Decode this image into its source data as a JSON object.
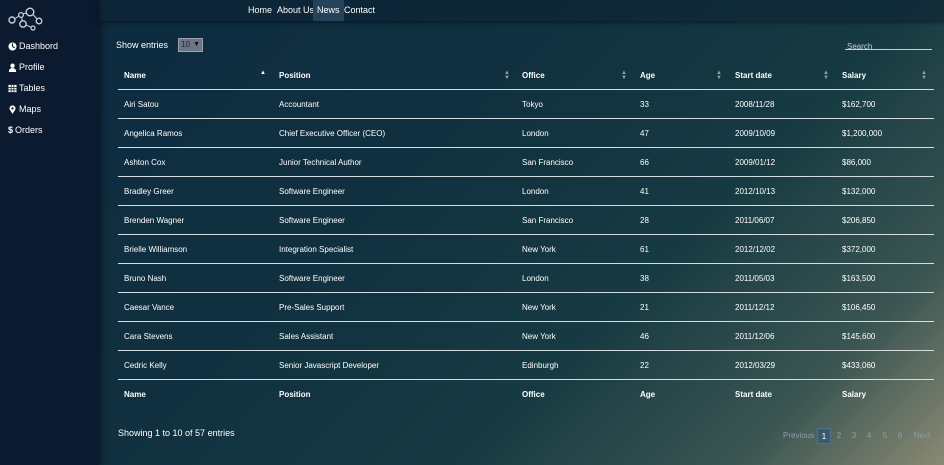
{
  "sidebar": {
    "items": [
      {
        "label": "Dashbord",
        "icon": "dashboard-icon"
      },
      {
        "label": "Profile",
        "icon": "user-icon"
      },
      {
        "label": "Tables",
        "icon": "table-icon"
      },
      {
        "label": "Maps",
        "icon": "map-marker-icon"
      },
      {
        "label": "Orders",
        "icon": "dollar-icon"
      }
    ]
  },
  "nav": {
    "links": [
      "Home",
      "About Us",
      "News",
      "Contact"
    ],
    "active": "News"
  },
  "controls": {
    "show_entries_label": "Show entries",
    "entries_value": "10",
    "search_placeholder": "Search"
  },
  "table": {
    "columns": [
      "Name",
      "Position",
      "Office",
      "Age",
      "Start date",
      "Salary"
    ],
    "sorted_column": "Name",
    "sort_direction": "ascending",
    "rows": [
      [
        "Airi Satou",
        "Accountant",
        "Tokyo",
        "33",
        "2008/11/28",
        "$162,700"
      ],
      [
        "Angelica Ramos",
        "Chief Executive Officer (CEO)",
        "London",
        "47",
        "2009/10/09",
        "$1,200,000"
      ],
      [
        "Ashton Cox",
        "Junior Technical Author",
        "San Francisco",
        "66",
        "2009/01/12",
        "$86,000"
      ],
      [
        "Bradley Greer",
        "Software Engineer",
        "London",
        "41",
        "2012/10/13",
        "$132,000"
      ],
      [
        "Brenden Wagner",
        "Software Engineer",
        "San Francisco",
        "28",
        "2011/06/07",
        "$206,850"
      ],
      [
        "Brielle Williamson",
        "Integration Specialist",
        "New York",
        "61",
        "2012/12/02",
        "$372,000"
      ],
      [
        "Bruno Nash",
        "Software Engineer",
        "London",
        "38",
        "2011/05/03",
        "$163,500"
      ],
      [
        "Caesar Vance",
        "Pre-Sales Support",
        "New York",
        "21",
        "2011/12/12",
        "$106,450"
      ],
      [
        "Cara Stevens",
        "Sales Assistant",
        "New York",
        "46",
        "2011/12/06",
        "$145,600"
      ],
      [
        "Cedric Kelly",
        "Senior Javascript Developer",
        "Edinburgh",
        "22",
        "2012/03/29",
        "$433,060"
      ]
    ]
  },
  "footer": {
    "info": "Showing 1 to 10 of 57 entries",
    "previous_label": "Previous",
    "next_label": "Next",
    "pages": [
      "1",
      "2",
      "3",
      "4",
      "5",
      "6"
    ],
    "current_page": "1"
  },
  "colors": {
    "sidebar_bg": "#0b1a2e",
    "active_nav_bg": "#26425a",
    "current_page_bg": "#3a5a72"
  }
}
